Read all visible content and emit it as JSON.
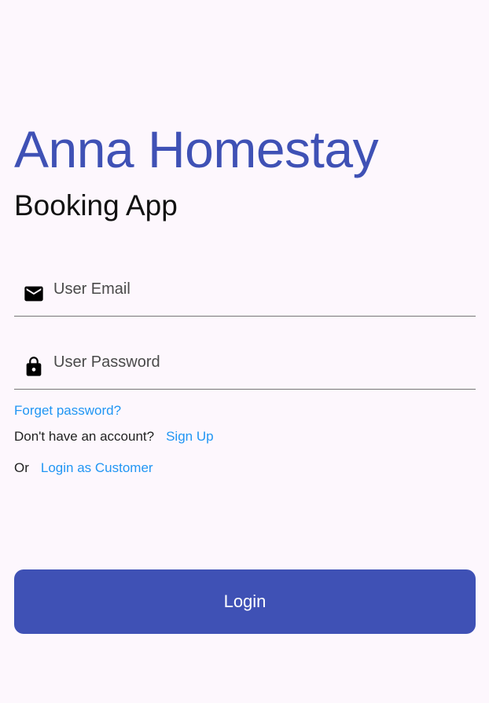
{
  "header": {
    "title": "Anna Homestay",
    "subtitle": "Booking App"
  },
  "form": {
    "email": {
      "placeholder": "User Email",
      "value": "",
      "icon": "email-icon"
    },
    "password": {
      "placeholder": "User Password",
      "value": "",
      "icon": "lock-icon"
    }
  },
  "links": {
    "forgot_password": "Forget password?",
    "no_account_text": "Don't have an account?",
    "sign_up": "Sign Up",
    "or_text": "Or",
    "login_as_customer": "Login as Customer"
  },
  "actions": {
    "login_label": "Login"
  },
  "colors": {
    "primary": "#3f51b5",
    "link": "#2196f3",
    "background": "#fdf7fd",
    "divider": "#777777"
  }
}
